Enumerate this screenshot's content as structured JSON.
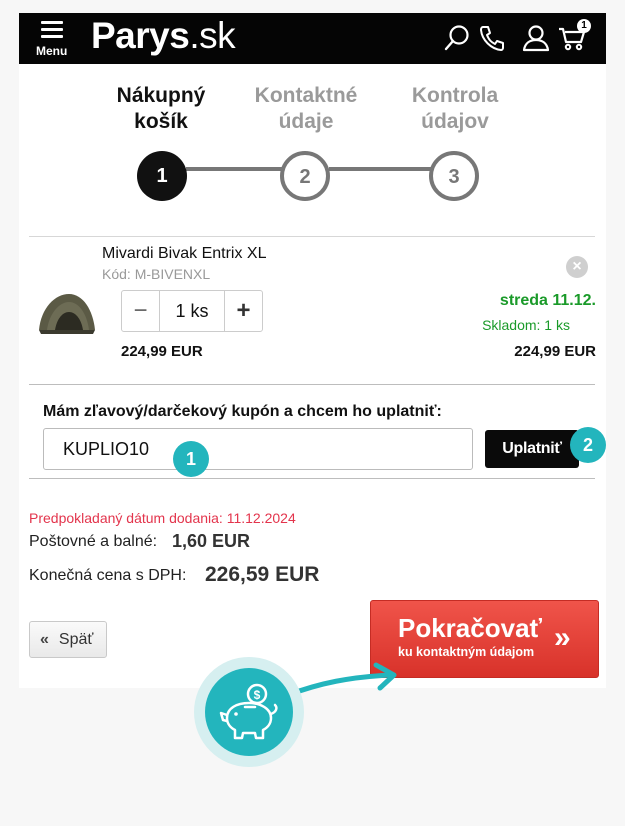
{
  "header": {
    "menu_label": "Menu",
    "logo_main": "Parys",
    "logo_tld": ".sk",
    "cart_count": "1",
    "icons": [
      "search-icon",
      "phone-icon",
      "user-icon",
      "cart-icon"
    ]
  },
  "steps": [
    {
      "label_line1": "Nákupný",
      "label_line2": "košík",
      "number": "1",
      "active": true
    },
    {
      "label_line1": "Kontaktné",
      "label_line2": "údaje",
      "number": "2",
      "active": false
    },
    {
      "label_line1": "Kontrola",
      "label_line2": "údajov",
      "number": "3",
      "active": false
    }
  ],
  "product": {
    "name": "Mivardi Bivak Entrix XL",
    "code": "Kód: M-BIVENXL",
    "quantity": "1 ks",
    "unit_price": "224,99 EUR",
    "delivery": "streda 11.12.",
    "stock": "Skladom: 1 ks",
    "total_price": "224,99 EUR"
  },
  "coupon": {
    "label": "Mám zľavový/darčekový kupón a chcem ho uplatniť:",
    "value": "KUPLIO10",
    "apply_label": "Uplatniť",
    "marker_input": "1",
    "marker_button": "2"
  },
  "summary": {
    "eta": "Predpokladaný dátum dodania: 11.12.2024",
    "shipping_label": "Poštovné a balné:",
    "shipping_value": "1,60 EUR",
    "total_label": "Konečná cena s DPH:",
    "total_value": "226,59 EUR"
  },
  "actions": {
    "back_label": "Späť",
    "continue_title": "Pokračovať",
    "continue_sub": "ku kontaktným údajom"
  },
  "colors": {
    "accent_teal": "#23b5bd",
    "continue_red": "#e5413a",
    "stock_green": "#1a9a29",
    "eta_red": "#e3344c"
  }
}
